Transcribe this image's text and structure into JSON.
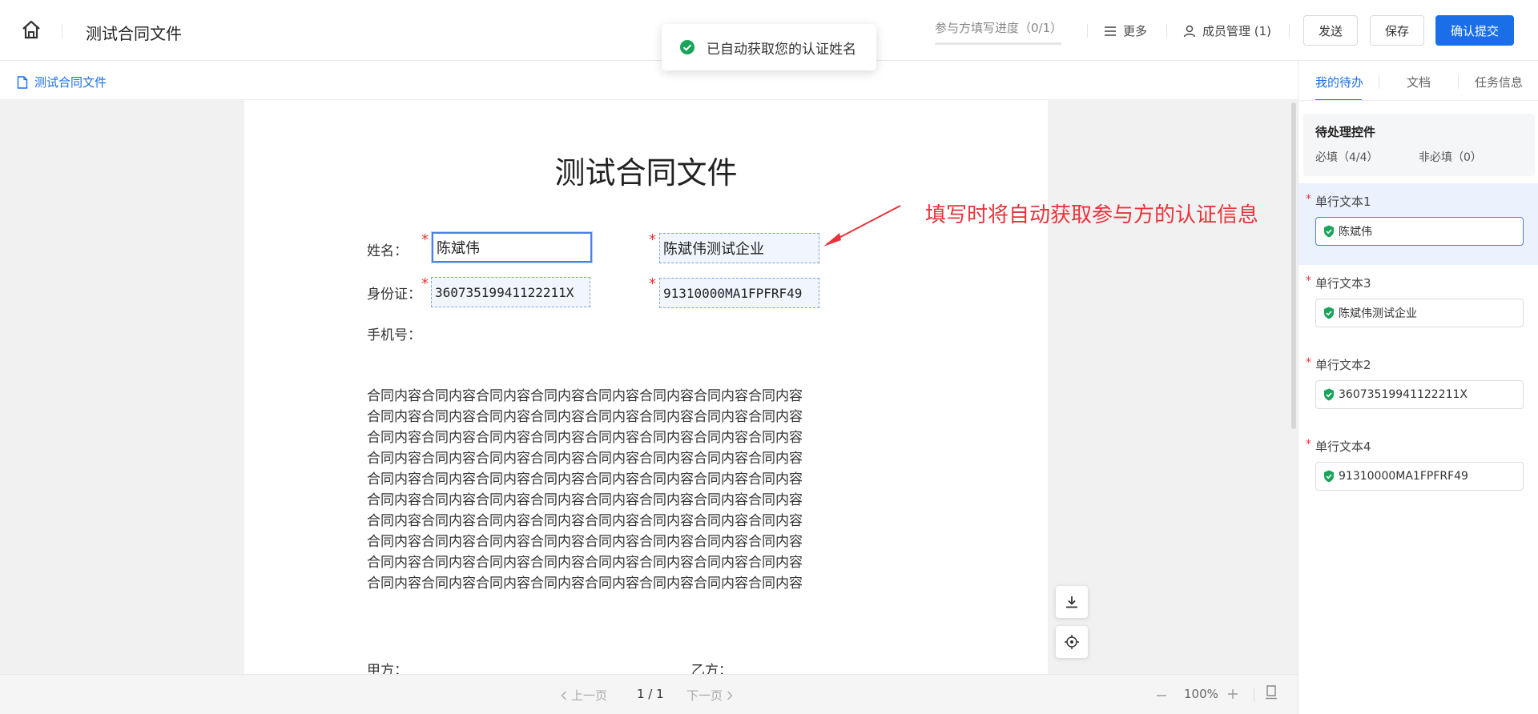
{
  "header": {
    "title": "测试合同文件",
    "progress_label": "参与方填写进度（0/1）",
    "progress_fraction": 0,
    "more_label": "更多",
    "members_label": "成员管理 (1)",
    "send_label": "发送",
    "save_label": "保存",
    "submit_label": "确认提交"
  },
  "toast": {
    "message": "已自动获取您的认证姓名"
  },
  "doc_tab": {
    "label": "测试合同文件"
  },
  "document": {
    "title": "测试合同文件",
    "name_label": "姓名：",
    "id_label": "身份证：",
    "phone_label": "手机号：",
    "required_mark": "*",
    "fields": {
      "name_value": "陈斌伟",
      "company_value": "陈斌伟测试企业",
      "id_value": "3607351994112221​1X",
      "credit_code_value": "91310000MA1FPFRF49"
    },
    "body_lines": [
      "合同内容合同内容合同内容合同内容合同内容合同内容合同内容合同内容",
      "合同内容合同内容合同内容合同内容合同内容合同内容合同内容合同内容",
      "合同内容合同内容合同内容合同内容合同内容合同内容合同内容合同内容",
      "合同内容合同内容合同内容合同内容合同内容合同内容合同内容合同内容",
      "合同内容合同内容合同内容合同内容合同内容合同内容合同内容合同内容",
      "合同内容合同内容合同内容合同内容合同内容合同内容合同内容合同内容",
      "合同内容合同内容合同内容合同内容合同内容合同内容合同内容合同内容",
      "合同内容合同内容合同内容合同内容合同内容合同内容合同内容合同内容",
      "合同内容合同内容合同内容合同内容合同内容合同内容合同内容合同内容",
      "合同内容合同内容合同内容合同内容合同内容合同内容合同内容合同内容"
    ],
    "party_a_label": "甲方：",
    "party_b_label": "乙方："
  },
  "annotation": {
    "text": "填写时将自动获取参与方的认证信息"
  },
  "pager": {
    "prev_label": "上一页",
    "current": "1 / 1",
    "next_label": "下一页",
    "zoom": "100%"
  },
  "right_panel": {
    "tabs": [
      "我的待办",
      "文档",
      "任务信息"
    ],
    "pending_title": "待处理控件",
    "required_stat": "必填（4/4）",
    "optional_stat": "非必填（0）",
    "fields": [
      {
        "label": "单行文本1",
        "value": "陈斌伟"
      },
      {
        "label": "单行文本3",
        "value": "陈斌伟测试企业"
      },
      {
        "label": "单行文本2",
        "value": "36073519941122211X"
      },
      {
        "label": "单行文本4",
        "value": "91310000MA1FPFRF49"
      }
    ]
  },
  "colors": {
    "accent": "#1a6fe8",
    "required": "#e8333b",
    "success": "#1aa35a"
  }
}
